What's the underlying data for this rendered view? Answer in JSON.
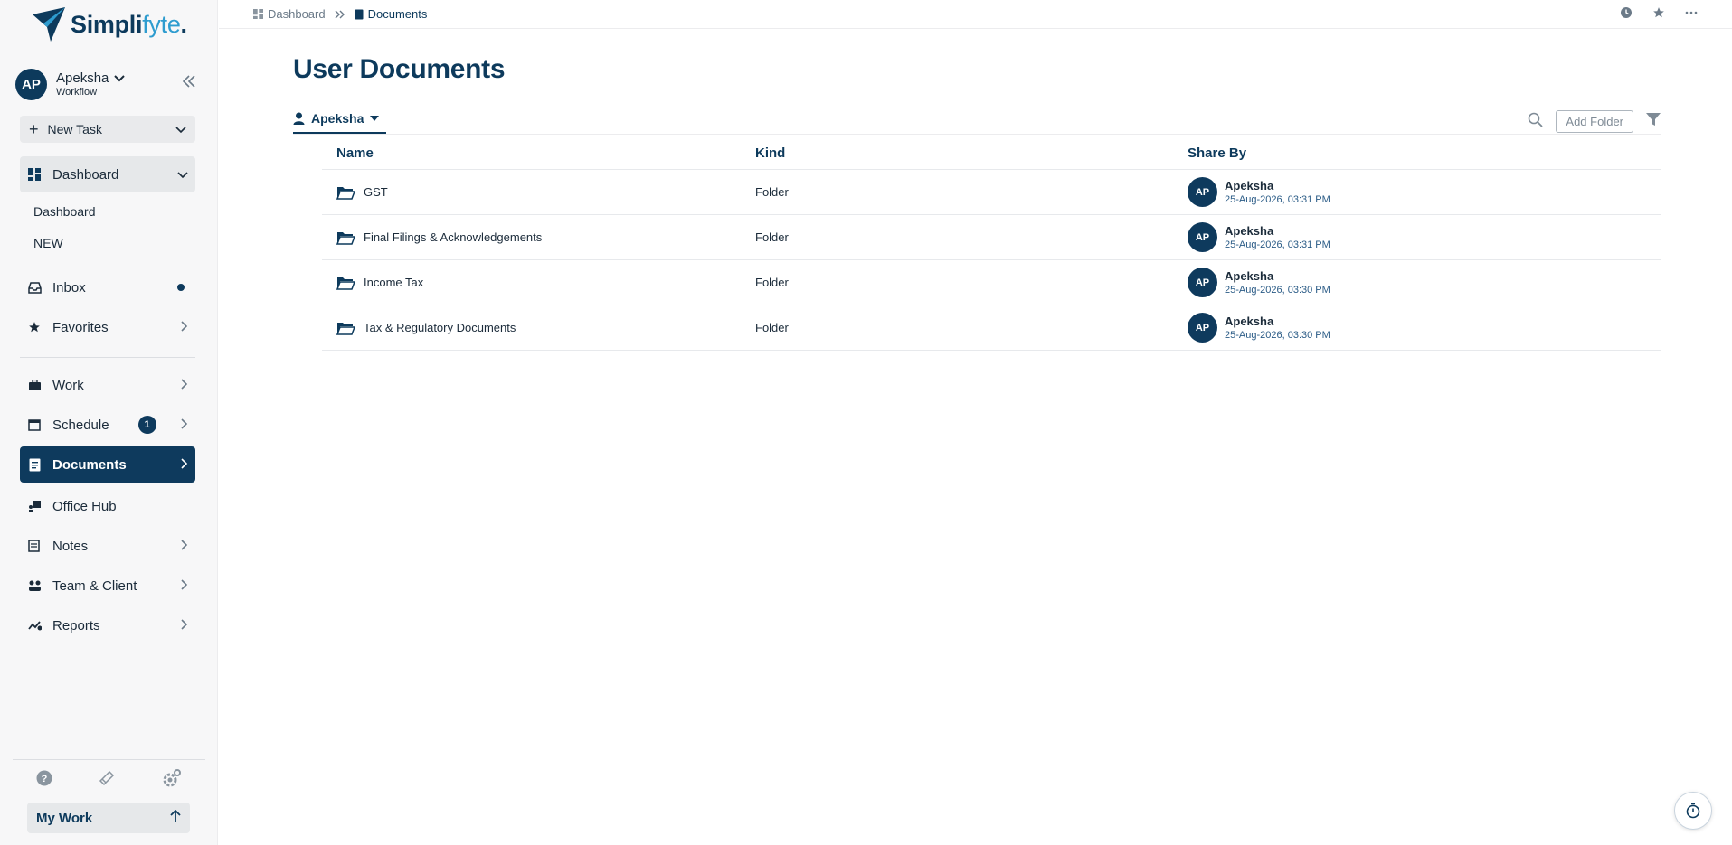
{
  "brand": {
    "logo_main": "Simpli",
    "logo_light": "fyte",
    "logo_dot": "."
  },
  "user": {
    "initials": "AP",
    "name": "Apeksha",
    "subtitle": "Workflow"
  },
  "new_task": {
    "label": "New Task"
  },
  "nav": {
    "dashboard": "Dashboard",
    "dashboard_sub": [
      "Dashboard",
      "NEW"
    ],
    "inbox": "Inbox",
    "favorites": "Favorites",
    "work": "Work",
    "schedule": "Schedule",
    "schedule_badge": "1",
    "documents": "Documents",
    "office_hub": "Office Hub",
    "notes": "Notes",
    "team_client": "Team & Client",
    "reports": "Reports"
  },
  "my_work": {
    "label": "My Work"
  },
  "breadcrumb": {
    "home": "Dashboard",
    "current": "Documents"
  },
  "page": {
    "title": "User Documents"
  },
  "user_tab": {
    "label": "Apeksha"
  },
  "toolbar": {
    "add_folder": "Add Folder"
  },
  "table": {
    "columns": [
      "Name",
      "Kind",
      "Share By"
    ],
    "rows": [
      {
        "name": "GST",
        "kind": "Folder",
        "initials": "AP",
        "by": "Apeksha",
        "date": "25-Aug-2026, 03:31 PM"
      },
      {
        "name": "Final Filings & Acknowledgements",
        "kind": "Folder",
        "initials": "AP",
        "by": "Apeksha",
        "date": "25-Aug-2026, 03:31 PM"
      },
      {
        "name": "Income Tax",
        "kind": "Folder",
        "initials": "AP",
        "by": "Apeksha",
        "date": "25-Aug-2026, 03:30 PM"
      },
      {
        "name": "Tax & Regulatory Documents",
        "kind": "Folder",
        "initials": "AP",
        "by": "Apeksha",
        "date": "25-Aug-2026, 03:30 PM"
      }
    ]
  },
  "colors": {
    "brand_navy": "#0d3a5c",
    "brand_light": "#2e9ccf",
    "active_bg": "#0e3a5d"
  }
}
